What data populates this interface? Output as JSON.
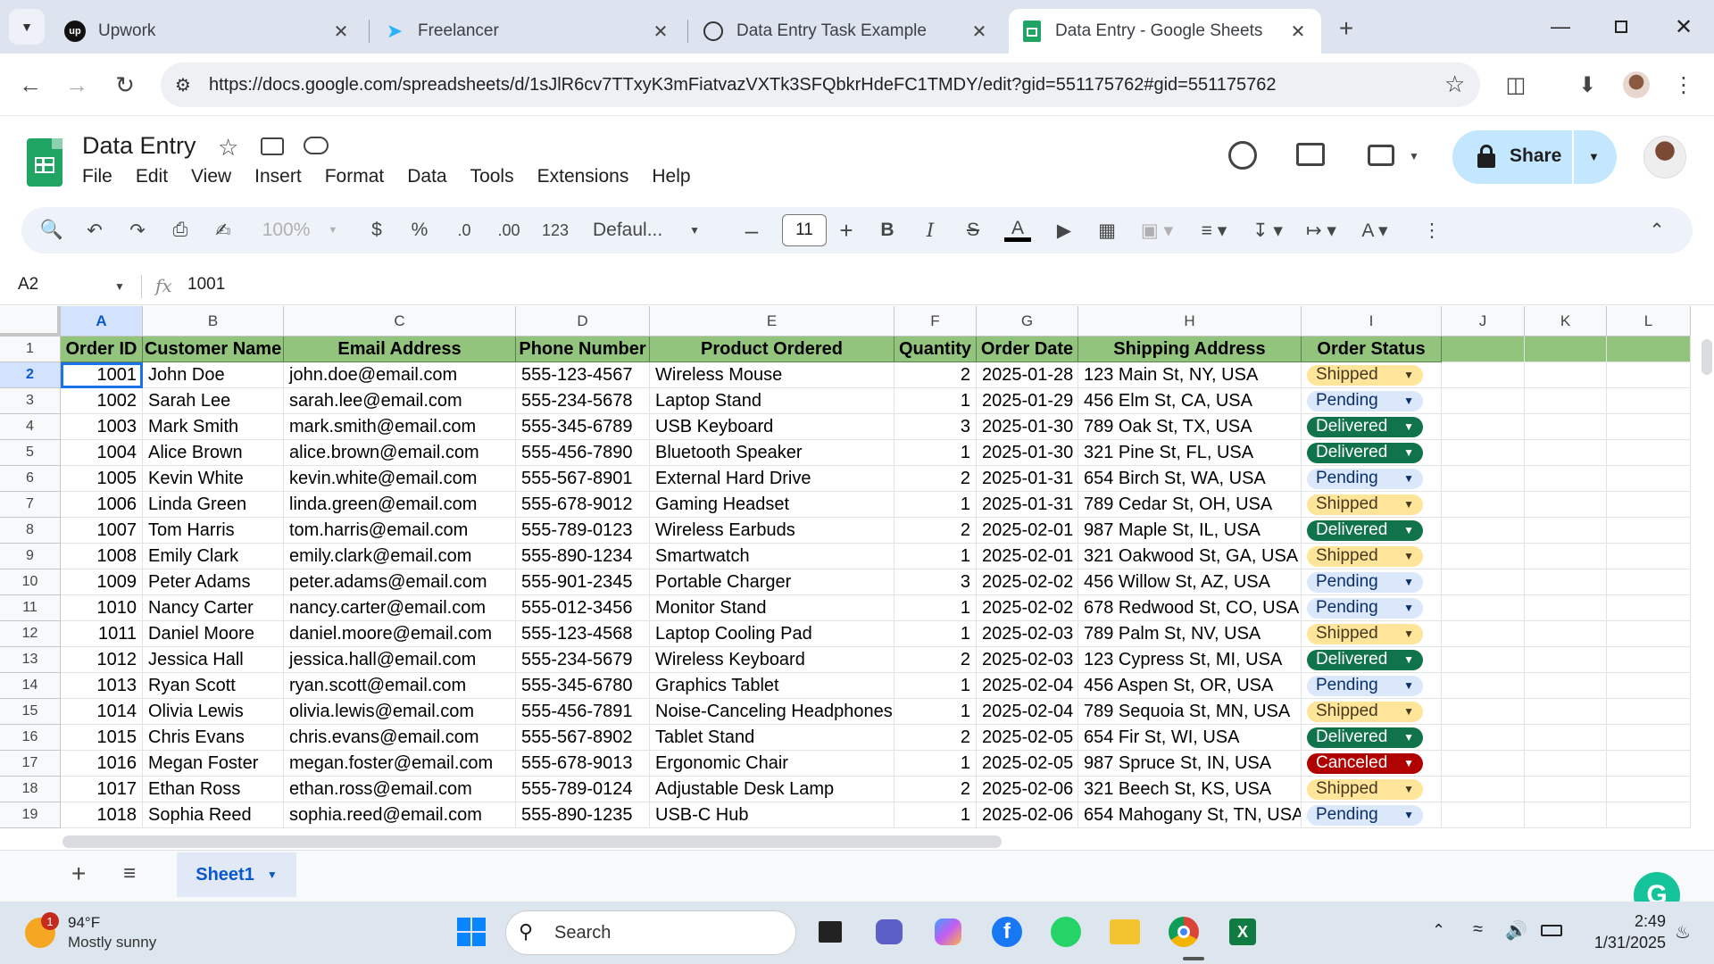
{
  "browser": {
    "tabs": [
      {
        "title": "Upwork",
        "icon": "upwork-icon"
      },
      {
        "title": "Freelancer",
        "icon": "freelancer-icon"
      },
      {
        "title": "Data Entry Task Example",
        "icon": "chatgpt-icon"
      },
      {
        "title": "Data Entry - Google Sheets",
        "icon": "sheets-icon",
        "active": true
      }
    ],
    "url": "https://docs.google.com/spreadsheets/d/1sJlR6cv7TTxyK3mFiatvazVXTk3SFQbkrHdeFC1TMDY/edit?gid=551175762#gid=551175762"
  },
  "doc": {
    "title": "Data Entry",
    "menu": [
      "File",
      "Edit",
      "View",
      "Insert",
      "Format",
      "Data",
      "Tools",
      "Extensions",
      "Help"
    ],
    "share_label": "Share"
  },
  "toolbar": {
    "zoom": "100%",
    "currency": "$",
    "percent": "%",
    "dec_decrease": ".0",
    "dec_increase": ".00",
    "format_123": "123",
    "font": "Defaul...",
    "font_size": "11"
  },
  "formula": {
    "cell_ref": "A2",
    "value": "1001"
  },
  "sheet": {
    "columns": [
      "A",
      "B",
      "C",
      "D",
      "E",
      "F",
      "G",
      "H",
      "I",
      "J",
      "K",
      "L"
    ],
    "header": [
      "Order ID",
      "Customer Name",
      "Email Address",
      "Phone Number",
      "Product Ordered",
      "Quantity",
      "Order Date",
      "Shipping Address",
      "Order Status"
    ],
    "rows": [
      [
        "1001",
        "John Doe",
        "john.doe@email.com",
        "555-123-4567",
        "Wireless Mouse",
        "2",
        "2025-01-28",
        "123 Main St, NY, USA",
        "Shipped"
      ],
      [
        "1002",
        "Sarah Lee",
        "sarah.lee@email.com",
        "555-234-5678",
        "Laptop Stand",
        "1",
        "2025-01-29",
        "456 Elm St, CA, USA",
        "Pending"
      ],
      [
        "1003",
        "Mark Smith",
        "mark.smith@email.com",
        "555-345-6789",
        "USB Keyboard",
        "3",
        "2025-01-30",
        "789 Oak St, TX, USA",
        "Delivered"
      ],
      [
        "1004",
        "Alice Brown",
        "alice.brown@email.com",
        "555-456-7890",
        "Bluetooth Speaker",
        "1",
        "2025-01-30",
        "321 Pine St, FL, USA",
        "Delivered"
      ],
      [
        "1005",
        "Kevin White",
        "kevin.white@email.com",
        "555-567-8901",
        "External Hard Drive",
        "2",
        "2025-01-31",
        "654 Birch St, WA, USA",
        "Pending"
      ],
      [
        "1006",
        "Linda Green",
        "linda.green@email.com",
        "555-678-9012",
        "Gaming Headset",
        "1",
        "2025-01-31",
        "789 Cedar St, OH, USA",
        "Shipped"
      ],
      [
        "1007",
        "Tom Harris",
        "tom.harris@email.com",
        "555-789-0123",
        "Wireless Earbuds",
        "2",
        "2025-02-01",
        "987 Maple St, IL, USA",
        "Delivered"
      ],
      [
        "1008",
        "Emily Clark",
        "emily.clark@email.com",
        "555-890-1234",
        "Smartwatch",
        "1",
        "2025-02-01",
        "321 Oakwood St, GA, USA",
        "Shipped"
      ],
      [
        "1009",
        "Peter Adams",
        "peter.adams@email.com",
        "555-901-2345",
        "Portable Charger",
        "3",
        "2025-02-02",
        "456 Willow St, AZ, USA",
        "Pending"
      ],
      [
        "1010",
        "Nancy Carter",
        "nancy.carter@email.com",
        "555-012-3456",
        "Monitor Stand",
        "1",
        "2025-02-02",
        "678 Redwood St, CO, USA",
        "Pending"
      ],
      [
        "1011",
        "Daniel Moore",
        "daniel.moore@email.com",
        "555-123-4568",
        "Laptop Cooling Pad",
        "1",
        "2025-02-03",
        "789 Palm St, NV, USA",
        "Shipped"
      ],
      [
        "1012",
        "Jessica Hall",
        "jessica.hall@email.com",
        "555-234-5679",
        "Wireless Keyboard",
        "2",
        "2025-02-03",
        "123 Cypress St, MI, USA",
        "Delivered"
      ],
      [
        "1013",
        "Ryan Scott",
        "ryan.scott@email.com",
        "555-345-6780",
        "Graphics Tablet",
        "1",
        "2025-02-04",
        "456 Aspen St, OR, USA",
        "Pending"
      ],
      [
        "1014",
        "Olivia Lewis",
        "olivia.lewis@email.com",
        "555-456-7891",
        "Noise-Canceling Headphones",
        "1",
        "2025-02-04",
        "789 Sequoia St, MN, USA",
        "Shipped"
      ],
      [
        "1015",
        "Chris Evans",
        "chris.evans@email.com",
        "555-567-8902",
        "Tablet Stand",
        "2",
        "2025-02-05",
        "654 Fir St, WI, USA",
        "Delivered"
      ],
      [
        "1016",
        "Megan Foster",
        "megan.foster@email.com",
        "555-678-9013",
        "Ergonomic Chair",
        "1",
        "2025-02-05",
        "987 Spruce St, IN, USA",
        "Canceled"
      ],
      [
        "1017",
        "Ethan Ross",
        "ethan.ross@email.com",
        "555-789-0124",
        "Adjustable Desk Lamp",
        "2",
        "2025-02-06",
        "321 Beech St, KS, USA",
        "Shipped"
      ],
      [
        "1018",
        "Sophia Reed",
        "sophia.reed@email.com",
        "555-890-1235",
        "USB-C Hub",
        "1",
        "2025-02-06",
        "654 Mahogany St, TN, USA",
        "Pending"
      ]
    ],
    "status_colors": {
      "Shipped": {
        "bg": "#ffe599",
        "fg": "#473821"
      },
      "Pending": {
        "bg": "#dbe7fb",
        "fg": "#0a3069"
      },
      "Delivered": {
        "bg": "#11734b",
        "fg": "#ffffff"
      },
      "Canceled": {
        "bg": "#b10202",
        "fg": "#ffffff"
      }
    },
    "sheet_tab": "Sheet1"
  },
  "taskbar": {
    "weather_temp": "94°F",
    "weather_desc": "Mostly sunny",
    "weather_badge": "1",
    "search_placeholder": "Search",
    "time": "2:49",
    "date": "1/31/2025"
  }
}
